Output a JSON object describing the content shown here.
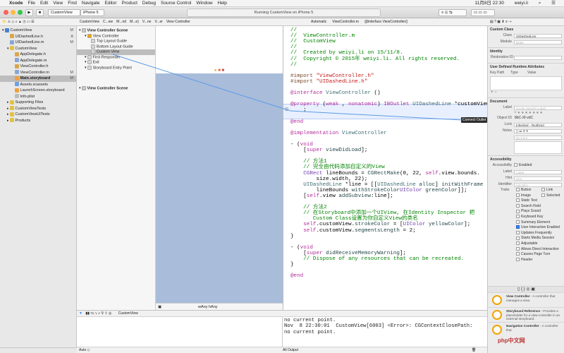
{
  "menubar": {
    "apple": "",
    "items": [
      "Xcode",
      "File",
      "Edit",
      "View",
      "Find",
      "Navigate",
      "Editor",
      "Product",
      "Debug",
      "Source Control",
      "Window",
      "Help"
    ],
    "clock": "11月8日 22:30",
    "user": "weiyi.li"
  },
  "toolbar": {
    "scheme": "CustomView",
    "device": "iPhone 5",
    "status": "Running CustomView on iPhone 5"
  },
  "jumpbar": {
    "canvas_crumbs": [
      "CustomView",
      "C...ew",
      "M...nd",
      "M...e)",
      "V...ne",
      "V...er",
      "View Controller"
    ],
    "editor_crumbs": [
      "Automatic",
      "ViewController.m",
      "@interface ViewController()"
    ],
    "outline_crumb": "CustomView"
  },
  "navigator": {
    "items": [
      {
        "label": "CustomView",
        "depth": 0,
        "badge": "M",
        "color": "#4a7fd6",
        "expanded": true
      },
      {
        "label": "UIDashedLine.h",
        "depth": 1,
        "badge": "A",
        "color": "#d8a64c"
      },
      {
        "label": "UIDashedLine.m",
        "depth": 1,
        "badge": "M",
        "color": "#8aa6d6"
      },
      {
        "label": "CustomView",
        "depth": 1,
        "badge": "",
        "color": "#e2c04a",
        "expanded": true
      },
      {
        "label": "AppDelegate.h",
        "depth": 2,
        "badge": "",
        "color": "#d8a64c"
      },
      {
        "label": "AppDelegate.m",
        "depth": 2,
        "badge": "",
        "color": "#8aa6d6"
      },
      {
        "label": "ViewController.h",
        "depth": 2,
        "badge": "",
        "color": "#d8a64c"
      },
      {
        "label": "ViewController.m",
        "depth": 2,
        "badge": "M",
        "color": "#8aa6d6"
      },
      {
        "label": "Main.storyboard",
        "depth": 2,
        "badge": "M",
        "color": "#f0a040",
        "selected": true
      },
      {
        "label": "Assets.xcassets",
        "depth": 2,
        "badge": "",
        "color": "#6fa0e0"
      },
      {
        "label": "LaunchScreen.storyboard",
        "depth": 2,
        "badge": "",
        "color": "#f0a040"
      },
      {
        "label": "Info.plist",
        "depth": 2,
        "badge": "",
        "color": "#bcbcbc"
      },
      {
        "label": "Supporting Files",
        "depth": 1,
        "badge": "",
        "color": "#e2c04a"
      },
      {
        "label": "CustomViewTests",
        "depth": 1,
        "badge": "",
        "color": "#e2c04a"
      },
      {
        "label": "CustomViewUITests",
        "depth": 1,
        "badge": "",
        "color": "#e2c04a"
      },
      {
        "label": "Products",
        "depth": 1,
        "badge": "",
        "color": "#e2c04a"
      }
    ]
  },
  "outline": {
    "items": [
      {
        "label": "View Controller Scene",
        "depth": 0,
        "bold": true
      },
      {
        "label": "View Controller",
        "depth": 1
      },
      {
        "label": "Top Layout Guide",
        "depth": 2
      },
      {
        "label": "Bottom Layout Guide",
        "depth": 2
      },
      {
        "label": "Custom View",
        "depth": 2,
        "selected": true
      },
      {
        "label": "First Responder",
        "depth": 1
      },
      {
        "label": "Exit",
        "depth": 1
      },
      {
        "label": "Storyboard Entry Point",
        "depth": 1
      },
      {
        "label": "View Controller Scene",
        "depth": 0,
        "bold": true
      }
    ]
  },
  "canvas": {
    "size_class": "wAny hAny"
  },
  "editor": {
    "lines": [
      [
        [
          "c-cm",
          "//"
        ]
      ],
      [
        [
          "c-cm",
          "//  ViewController.m"
        ]
      ],
      [
        [
          "c-cm",
          "//  CustomView"
        ]
      ],
      [
        [
          "c-cm",
          "//"
        ]
      ],
      [
        [
          "c-cm",
          "//  Created by weiyi.li on 15/11/8."
        ]
      ],
      [
        [
          "c-cm",
          "//  Copyright © 2015年 weiyi.li. All rights reserved."
        ]
      ],
      [
        [
          "c-cm",
          "//"
        ]
      ],
      [
        [
          "",
          ""
        ]
      ],
      [
        [
          "c-pp",
          "#import "
        ],
        [
          "c-st",
          "\"ViewController.h\""
        ]
      ],
      [
        [
          "c-pp",
          "#import "
        ],
        [
          "c-st",
          "\"UIDashedLine.h\""
        ]
      ],
      [
        [
          "",
          ""
        ]
      ],
      [
        [
          "c-kw",
          "@interface"
        ],
        [
          "",
          " "
        ],
        [
          "c-ty",
          "ViewController"
        ],
        [
          "",
          " ()"
        ]
      ],
      [
        [
          "",
          ""
        ]
      ],
      [
        [
          "c-kw",
          "@property"
        ],
        [
          "",
          " ("
        ],
        [
          "c-kw",
          "weak"
        ],
        [
          "",
          " , "
        ],
        [
          "c-kw",
          "nonatomic"
        ],
        [
          "",
          ") "
        ],
        [
          "c-kw",
          "IBOutlet"
        ],
        [
          "",
          " "
        ],
        [
          "c-ty",
          "UIDashedLine"
        ],
        [
          "",
          " *customView"
        ]
      ],
      [
        [
          "",
          "    ;"
        ]
      ],
      [
        [
          "",
          ""
        ]
      ],
      [
        [
          "c-kw",
          "@end"
        ]
      ],
      [
        [
          "",
          ""
        ]
      ],
      [
        [
          "c-kw",
          "@implementation"
        ],
        [
          "",
          " "
        ],
        [
          "c-ty",
          "ViewController"
        ]
      ],
      [
        [
          "",
          ""
        ]
      ],
      [
        [
          "",
          "- ("
        ],
        [
          "c-kw",
          "void"
        ],
        [
          ")viewDidLoad {"
        ]
      ],
      [
        [
          "",
          "    ["
        ],
        [
          "c-kw",
          "super"
        ],
        [
          "",
          " "
        ],
        [
          "c-fn",
          "viewDidLoad"
        ],
        [
          "",
          "];"
        ]
      ],
      [
        [
          "",
          ""
        ]
      ],
      [
        [
          "c-cm",
          "    // 方法1"
        ]
      ],
      [
        [
          "c-cm",
          "    // 完全由代码添加自定义的View"
        ]
      ],
      [
        [
          "c-cls",
          "    CGRect"
        ],
        [
          "",
          " lineBounds = "
        ],
        [
          "c-fn",
          "CGRectMake"
        ],
        [
          "",
          "(0, 22, "
        ],
        [
          "c-kw",
          "self"
        ],
        [
          "",
          ".view.bounds."
        ]
      ],
      [
        [
          "",
          "        size.width, 22);"
        ]
      ],
      [
        [
          "c-ty",
          "    UIDashedLine"
        ],
        [
          "",
          " *line = [["
        ],
        [
          "c-ty",
          "UIDashedLine"
        ],
        [
          "",
          " "
        ],
        [
          "c-fn",
          "alloc"
        ],
        [
          "",
          "] "
        ],
        [
          "c-fn",
          "initWithFrame"
        ],
        [
          ":"
        ]
      ],
      [
        [
          "",
          "        lineBounds "
        ],
        [
          "c-fn",
          "withStrokeColor"
        ],
        [
          ":["
        ],
        [
          "c-cls",
          "UIColor"
        ],
        [
          "",
          " "
        ],
        [
          "c-fn",
          "greenColor"
        ],
        [
          "",
          "]];"
        ]
      ],
      [
        [
          "",
          "    ["
        ],
        [
          "c-kw",
          "self"
        ],
        [
          "",
          ".view "
        ],
        [
          "c-fn",
          "addSubview"
        ],
        [
          "",
          ":line];"
        ]
      ],
      [
        [
          "",
          ""
        ]
      ],
      [
        [
          "c-cm",
          "    // 方法2"
        ]
      ],
      [
        [
          "c-cm",
          "    // 在Storyboard中添加一个UIView, 在Identity Inspector 把"
        ]
      ],
      [
        [
          "c-cm",
          "       Custom Class设置为你自定义View的类名"
        ]
      ],
      [
        [
          "c-kw",
          "    self"
        ],
        [
          "",
          ".customView."
        ],
        [
          "c-fn",
          "strokeColor"
        ],
        [
          "",
          " = ["
        ],
        [
          "c-cls",
          "UIColor"
        ],
        [
          "",
          " "
        ],
        [
          "c-fn",
          "yellowColor"
        ],
        [
          "",
          "];"
        ]
      ],
      [
        [
          "c-kw",
          "    self"
        ],
        [
          "",
          ".customView."
        ],
        [
          "c-fn",
          "segmentsLength"
        ],
        [
          "",
          " = 2;"
        ]
      ],
      [
        [
          "",
          "}"
        ]
      ],
      [
        [
          "",
          ""
        ]
      ],
      [
        [
          "",
          "- ("
        ],
        [
          "c-kw",
          "void"
        ],
        [
          ")didReceiveMemoryWarning {"
        ]
      ],
      [
        [
          "",
          "    ["
        ],
        [
          "c-kw",
          "super"
        ],
        [
          "",
          " "
        ],
        [
          "c-fn",
          "didReceiveMemoryWarning"
        ],
        [
          "",
          "];"
        ]
      ],
      [
        [
          "c-cm",
          "    // Dispose of any resources that can be recreated."
        ]
      ],
      [
        [
          "",
          "}"
        ]
      ],
      [
        [
          "",
          ""
        ]
      ],
      [
        [
          "c-kw",
          "@end"
        ]
      ]
    ],
    "tooltip": "Connect Outlet"
  },
  "inspector": {
    "custom_class": {
      "title": "Custom Class",
      "class_label": "Class",
      "class_value": "UIDashedLine",
      "module_label": "Module",
      "module_value": "None"
    },
    "identity": {
      "title": "Identity",
      "restoration_label": "Restoration ID"
    },
    "runtime": {
      "title": "User Defined Runtime Attributes",
      "cols": [
        "Key Path",
        "Type",
        "Value"
      ]
    },
    "document": {
      "title": "Document",
      "label_label": "Label",
      "label_ph": "Xcode Specific Label",
      "objid_label": "Object ID",
      "objid_value": "8bC-Xf-vdC",
      "lock_label": "Lock",
      "lock_value": "Inherited - (Nothing)",
      "notes_label": "Notes",
      "font_ph": "No Font"
    },
    "accessibility": {
      "title": "Accessibility",
      "access_label": "Accessibility",
      "enabled": "Enabled",
      "label_label": "Label",
      "label_ph": "Label",
      "hint_label": "Hint",
      "hint_ph": "Hint",
      "id_label": "Identifier",
      "id_ph": "Identifier",
      "traits_label": "Traits"
    },
    "traits": [
      {
        "label": "Button",
        "on": false,
        "right": "Link"
      },
      {
        "label": "Image",
        "on": false,
        "right": "Selected"
      },
      {
        "label": "Static Text",
        "on": false
      },
      {
        "label": "Search Field",
        "on": false
      },
      {
        "label": "Plays Sound",
        "on": false
      },
      {
        "label": "Keyboard Key",
        "on": false
      },
      {
        "label": "Summary Element",
        "on": false
      },
      {
        "label": "User Interaction Enabled",
        "on": true
      },
      {
        "label": "Updates Frequently",
        "on": false
      },
      {
        "label": "Starts Media Session",
        "on": false
      },
      {
        "label": "Adjustable",
        "on": false
      },
      {
        "label": "Allows Direct Interaction",
        "on": false
      },
      {
        "label": "Causes Page Turn",
        "on": false
      },
      {
        "label": "Header",
        "on": false
      }
    ],
    "library": [
      {
        "title": "View Controller",
        "desc": "A controller that manages a view."
      },
      {
        "title": "Storyboard Reference",
        "desc": "Provides a placeholder for a view controller in an external storyboard."
      },
      {
        "title": "Navigation Controller",
        "desc": "A controller that"
      }
    ]
  },
  "debug": {
    "crumb": "CustomView",
    "vars_scope": "Auto",
    "console_lines": [
      "no current point.",
      "Nov  8 22:30:01  CustomView[6003] <Error>: CGContextClosePath:",
      "no current point."
    ],
    "console_filter": "All Output"
  },
  "watermark": "php中文网",
  "colors": {
    "scene_bg": "#a9bcda",
    "accent": "#3b82f6",
    "highlight": "#e8f0ff"
  }
}
